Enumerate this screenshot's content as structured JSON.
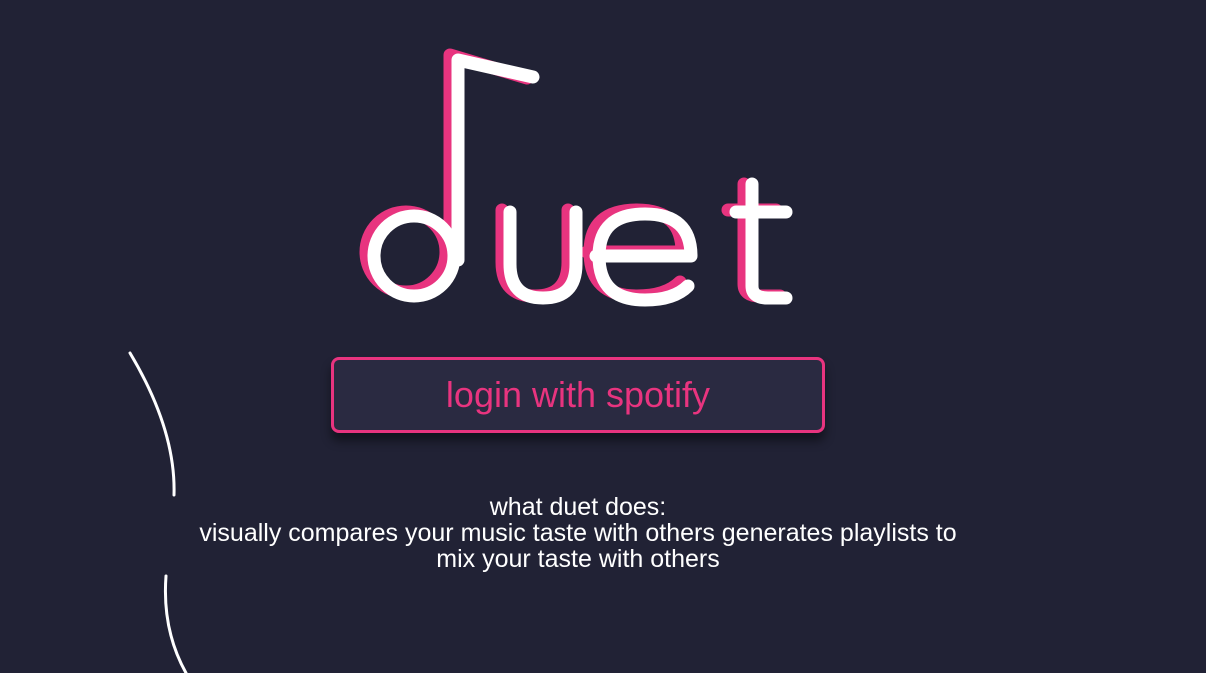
{
  "logo": {
    "text": "duet",
    "primary_color": "#ffffff",
    "shadow_color": "#e8347f",
    "icon": "music-note-icon"
  },
  "login_button": {
    "label": "login with spotify"
  },
  "description": {
    "heading": "what duet does:",
    "line_1": "visually compares your music taste with others generates playlists to",
    "line_2": "mix your taste with others"
  },
  "colors": {
    "background": "#212235",
    "accent": "#e8347f",
    "button_fill": "#2a2a41",
    "text": "#ffffff"
  }
}
